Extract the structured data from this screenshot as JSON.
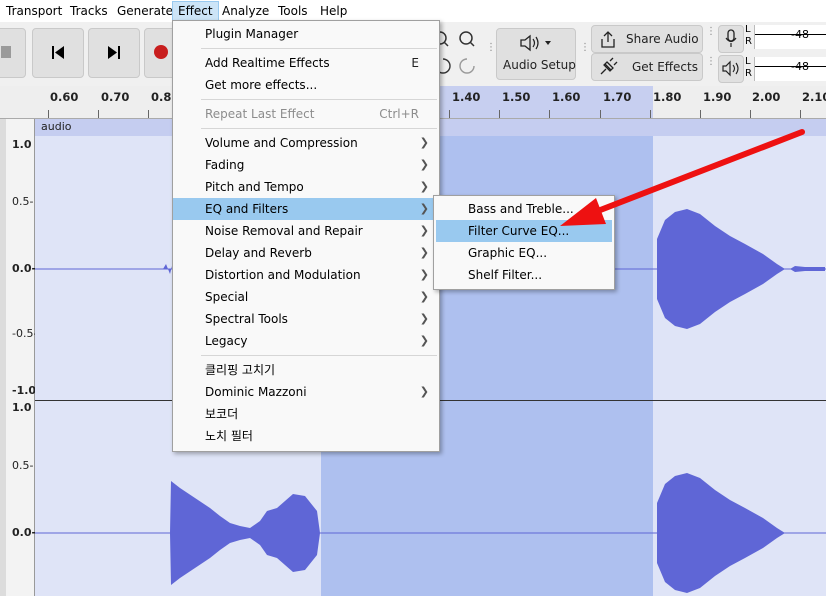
{
  "menubar": {
    "items": [
      "Transport",
      "Tracks",
      "Generate",
      "Effect",
      "Analyze",
      "Tools",
      "Help"
    ]
  },
  "toolbar": {
    "share_audio_label": "Share Audio",
    "get_effects_label": "Get Effects",
    "audio_setup_label": "Audio Setup",
    "meter_record": {
      "l": "L",
      "r": "R",
      "value": "-48"
    },
    "meter_play": {
      "l": "L",
      "r": "R",
      "value": "-48"
    }
  },
  "ruler": {
    "ticks": [
      "0.60",
      "0.70",
      "0.80",
      "1.40",
      "1.50",
      "1.60",
      "1.70",
      "1.80",
      "1.90",
      "2.00",
      "2.10"
    ]
  },
  "track": {
    "clip_name": "audio",
    "scale_top": [
      "1.0",
      "0.5-",
      "0.0-",
      "-0.5-",
      "-1.0"
    ],
    "scale_bottom": [
      "1.0",
      "0.5-",
      "0.0-"
    ]
  },
  "effect_menu": {
    "items": [
      {
        "label": "Plugin Manager",
        "shortcut": "",
        "submenu": false,
        "disabled": false
      },
      {
        "label": "Add Realtime Effects",
        "shortcut": "E",
        "submenu": false,
        "disabled": false
      },
      {
        "label": "Get more effects...",
        "shortcut": "",
        "submenu": false,
        "disabled": false
      },
      {
        "label": "Repeat Last Effect",
        "shortcut": "Ctrl+R",
        "submenu": false,
        "disabled": true
      },
      {
        "label": "Volume and Compression",
        "shortcut": "",
        "submenu": true,
        "disabled": false
      },
      {
        "label": "Fading",
        "shortcut": "",
        "submenu": true,
        "disabled": false
      },
      {
        "label": "Pitch and Tempo",
        "shortcut": "",
        "submenu": true,
        "disabled": false
      },
      {
        "label": "EQ and Filters",
        "shortcut": "",
        "submenu": true,
        "disabled": false,
        "highlighted": true
      },
      {
        "label": "Noise Removal and Repair",
        "shortcut": "",
        "submenu": true,
        "disabled": false
      },
      {
        "label": "Delay and Reverb",
        "shortcut": "",
        "submenu": true,
        "disabled": false
      },
      {
        "label": "Distortion and Modulation",
        "shortcut": "",
        "submenu": true,
        "disabled": false
      },
      {
        "label": "Special",
        "shortcut": "",
        "submenu": true,
        "disabled": false
      },
      {
        "label": "Spectral Tools",
        "shortcut": "",
        "submenu": true,
        "disabled": false
      },
      {
        "label": "Legacy",
        "shortcut": "",
        "submenu": true,
        "disabled": false
      },
      {
        "label": "클리핑 고치기",
        "shortcut": "",
        "submenu": false,
        "disabled": false
      },
      {
        "label": "Dominic Mazzoni",
        "shortcut": "",
        "submenu": true,
        "disabled": false
      },
      {
        "label": "보코더",
        "shortcut": "",
        "submenu": false,
        "disabled": false
      },
      {
        "label": "노치 필터",
        "shortcut": "",
        "submenu": false,
        "disabled": false
      }
    ]
  },
  "eq_submenu": {
    "items": [
      {
        "label": "Bass and Treble...",
        "highlighted": false
      },
      {
        "label": "Filter Curve EQ...",
        "highlighted": true
      },
      {
        "label": "Graphic EQ...",
        "highlighted": false
      },
      {
        "label": "Shelf Filter...",
        "highlighted": false
      }
    ]
  },
  "colors": {
    "menu_highlight": "#99c9ef",
    "waveform": "#5f66d6",
    "selection": "#aec0ef",
    "annotation_arrow": "#ee1111"
  }
}
